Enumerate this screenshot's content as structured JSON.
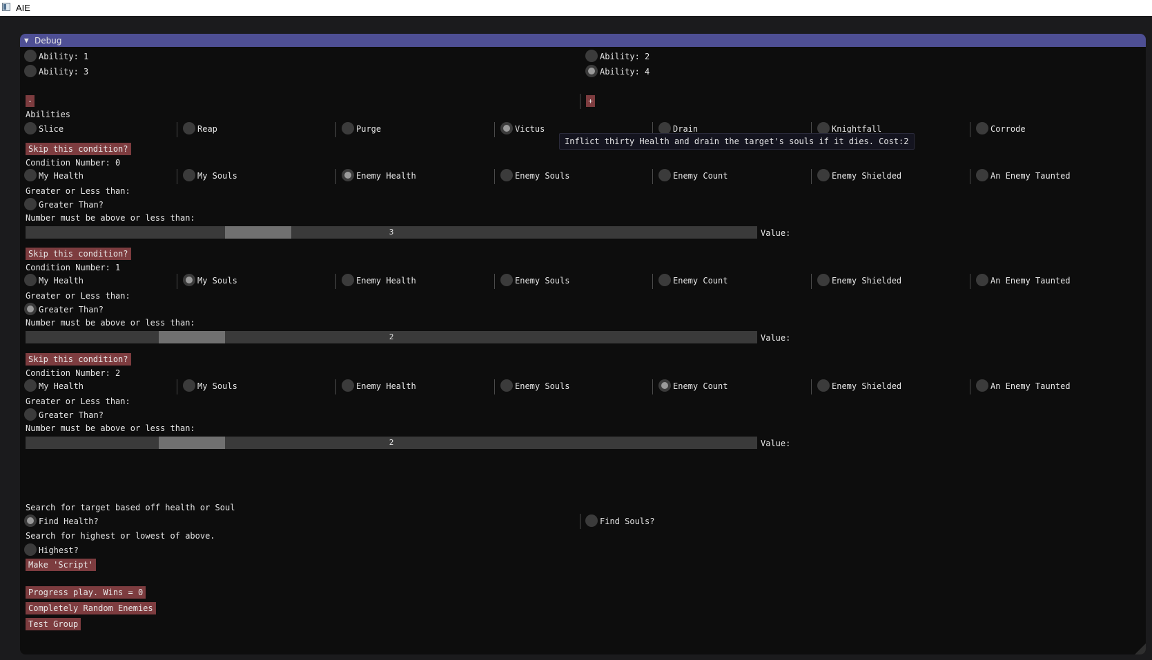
{
  "titlebar": {
    "title": "AIE"
  },
  "window": {
    "title": "Debug",
    "collapse_symbol": "▼"
  },
  "ability_radios": [
    {
      "label": "Ability: 1",
      "selected": false
    },
    {
      "label": "Ability: 2",
      "selected": false
    },
    {
      "label": "Ability: 3",
      "selected": false
    },
    {
      "label": "Ability: 4",
      "selected": true
    }
  ],
  "step_buttons": {
    "minus": "-",
    "plus": "+"
  },
  "abilities": {
    "heading": "Abilities",
    "options": [
      "Slice",
      "Reap",
      "Purge",
      "Victus",
      "Drain",
      "Knightfall",
      "Corrode"
    ],
    "selected": "Victus",
    "tooltip": "Inflict thirty Health and drain the target's souls if it dies. Cost:2"
  },
  "conditions": [
    {
      "skip_label": "Skip this condition?",
      "number_label": "Condition Number: 0",
      "options": [
        "My Health",
        "My Souls",
        "Enemy Health",
        "Enemy Souls",
        "Enemy Count",
        "Enemy Shielded",
        "An Enemy Taunted"
      ],
      "selected": "Enemy Health",
      "compare_heading": "Greater or Less than:",
      "greater_label": "Greater Than?",
      "greater_selected": false,
      "number_heading": "Number must be above or less than:",
      "slider_value": "3",
      "slider_fraction": 0.3,
      "value_label": "Value:"
    },
    {
      "skip_label": "Skip this condition?",
      "number_label": "Condition Number: 1",
      "options": [
        "My Health",
        "My Souls",
        "Enemy Health",
        "Enemy Souls",
        "Enemy Count",
        "Enemy Shielded",
        "An Enemy Taunted"
      ],
      "selected": "My Souls",
      "compare_heading": "Greater or Less than:",
      "greater_label": "Greater Than?",
      "greater_selected": true,
      "number_heading": "Number must be above or less than:",
      "slider_value": "2",
      "slider_fraction": 0.2,
      "value_label": "Value:"
    },
    {
      "skip_label": "Skip this condition?",
      "number_label": "Condition Number: 2",
      "options": [
        "My Health",
        "My Souls",
        "Enemy Health",
        "Enemy Souls",
        "Enemy Count",
        "Enemy Shielded",
        "An Enemy Taunted"
      ],
      "selected": "Enemy Count",
      "compare_heading": "Greater or Less than:",
      "greater_label": "Greater Than?",
      "greater_selected": false,
      "number_heading": "Number must be above or less than:",
      "slider_value": "2",
      "slider_fraction": 0.2,
      "value_label": "Value:"
    }
  ],
  "search": {
    "heading": "Search for target based off health or Soul",
    "find_health": "Find Health?",
    "find_health_selected": true,
    "find_souls": "Find Souls?",
    "find_souls_selected": false,
    "order_heading": "Search for highest or lowest of above.",
    "highest": "Highest?",
    "highest_selected": false
  },
  "actions": {
    "make_script": "Make 'Script'",
    "progress_play": "Progress play. Wins = 0",
    "random_enemies": "Completely Random Enemies",
    "test_group": "Test Group"
  },
  "colors": {
    "window_header": "#4e4f94",
    "button": "#7d3c3f",
    "window_bg": "#0d0d0d",
    "slider_bg": "#3a3a3a",
    "slider_grab": "#707070"
  }
}
